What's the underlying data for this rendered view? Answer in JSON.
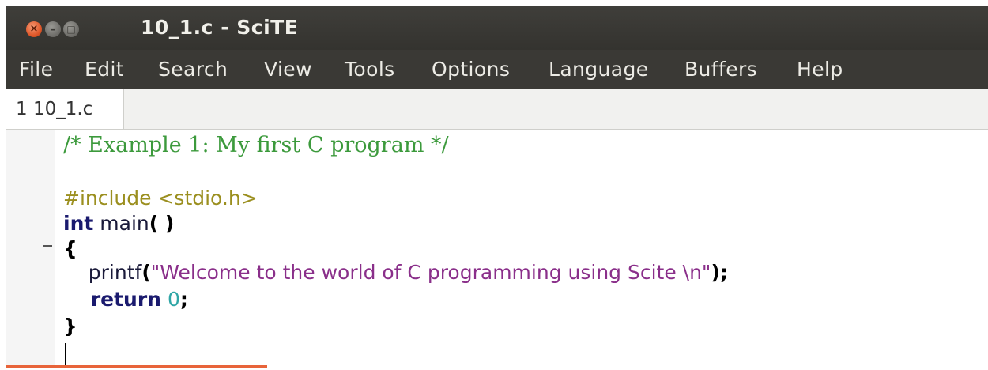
{
  "window": {
    "title": "10_1.c - SciTE",
    "controls": {
      "close_icon": "close-icon",
      "minimize_icon": "minimize-icon",
      "maximize_icon": "maximize-icon"
    }
  },
  "menubar": {
    "items": [
      "File",
      "Edit",
      "Search",
      "View",
      "Tools",
      "Options",
      "Language",
      "Buffers",
      "Help"
    ]
  },
  "tabs": [
    {
      "label": "1 10_1.c",
      "active": true
    }
  ],
  "editor": {
    "lines": [
      {
        "tokens": [
          {
            "type": "comment",
            "text": "/* Example 1: My first C program */"
          }
        ]
      },
      {
        "tokens": []
      },
      {
        "tokens": [
          {
            "type": "pre",
            "text": "#include <stdio.h>"
          }
        ]
      },
      {
        "tokens": [
          {
            "type": "kw",
            "text": "int"
          },
          {
            "type": "id",
            "text": " main"
          },
          {
            "type": "op",
            "text": "( )"
          }
        ]
      },
      {
        "tokens": [
          {
            "type": "op",
            "text": "{"
          }
        ]
      },
      {
        "tokens": [
          {
            "type": "id",
            "text": "    printf"
          },
          {
            "type": "op",
            "text": "("
          },
          {
            "type": "str",
            "text": "\"Welcome to the world of C programming using Scite \\n\""
          },
          {
            "type": "op",
            "text": ");"
          }
        ]
      },
      {
        "tokens": [
          {
            "type": "kw",
            "text": "    return"
          },
          {
            "type": "id",
            "text": " "
          },
          {
            "type": "num",
            "text": "0"
          },
          {
            "type": "op",
            "text": ";"
          }
        ]
      },
      {
        "tokens": [
          {
            "type": "op",
            "text": "}"
          }
        ]
      }
    ]
  },
  "colors": {
    "titlebar": "#3f3e3a",
    "menubar": "#3a3935",
    "comment": "#3c9a3c",
    "preprocessor": "#9b8f1f",
    "keyword": "#1a1a6e",
    "string": "#8a2f8a",
    "number": "#2fa6a6",
    "accent": "#e8643a"
  }
}
